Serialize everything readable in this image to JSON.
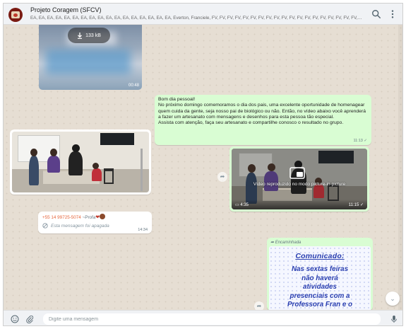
{
  "header": {
    "title": "Projeto Coragem (SFCV)",
    "participants": "EA, EA, EA, EA, EA, EA, EA, EA, EA, EA, EA, EA, EA, EA, EA, EA, EA, Everton, Franciele, FV, FV, FV, FV, FV, FV, FV, FV, FV, FV, FV, FV, FV, FV, FV, FV, FV, FV, FV, FV,..."
  },
  "messages": {
    "video_top": {
      "size": "133 kB",
      "duration": "00:48"
    },
    "text_msg": {
      "lines": [
        "Bom dia pessoal!",
        "No próximo domingo comemoramos o dia dos pais, uma excelente oportunidade de homenagear quem cuida da gente, seja nosso pai de biológico ou não. Então, no vídeo abaixo você aprenderá a fazer um artesanato com mensagens e desenhos para esta pessoa tão especial.",
        "Assista com atenção, faça seu artesanato e compartilhe conosco o resultado no grupo."
      ],
      "time": "11:13"
    },
    "video_right": {
      "overlay": "Vídeo reproduzido no modo picture-in-picture",
      "duration": "4:35",
      "time": "11:15"
    },
    "deleted": {
      "phone": "+55 14 99725-5074",
      "name_prefix": "~Profa",
      "text": "Esta mensagem foi apagada",
      "time": "14:34"
    },
    "comunicado": {
      "forwarded": "Encaminhada",
      "heading": "Comunicado:",
      "body": [
        "Nas sextas feiras",
        "não haverá",
        "atividades",
        "presenciais com a",
        "Professora Fran e o"
      ]
    }
  },
  "footer": {
    "placeholder": "Digite uma mensagem"
  },
  "colors": {
    "outgoing": "#d9fdd3",
    "incoming": "#ffffff",
    "poster_text": "#2a3fb0",
    "sender": "#e6653b"
  }
}
